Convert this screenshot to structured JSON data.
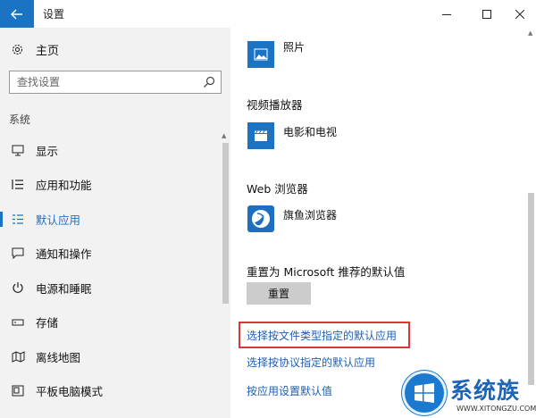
{
  "window": {
    "title": "设置",
    "back_icon": "arrow-left-icon",
    "controls": [
      "minimize-icon",
      "maximize-icon",
      "close-icon"
    ]
  },
  "sidebar": {
    "home_label": "主页",
    "home_icon": "gear-icon",
    "search": {
      "placeholder": "查找设置",
      "icon": "search-icon"
    },
    "section_label": "系统",
    "items": [
      {
        "label": "显示",
        "icon": "monitor-icon",
        "active": false
      },
      {
        "label": "应用和功能",
        "icon": "list-icon",
        "active": false
      },
      {
        "label": "默认应用",
        "icon": "default-apps-icon",
        "active": true
      },
      {
        "label": "通知和操作",
        "icon": "message-icon",
        "active": false
      },
      {
        "label": "电源和睡眠",
        "icon": "power-icon",
        "active": false
      },
      {
        "label": "存储",
        "icon": "storage-icon",
        "active": false
      },
      {
        "label": "离线地图",
        "icon": "map-icon",
        "active": false
      },
      {
        "label": "平板电脑模式",
        "icon": "tablet-icon",
        "active": false
      }
    ]
  },
  "content": {
    "photo_app": {
      "name": "照片",
      "icon": "photo-icon"
    },
    "video_heading": "视频播放器",
    "video_app": {
      "name": "电影和电视",
      "icon": "movie-clapper-icon"
    },
    "web_heading": "Web 浏览器",
    "web_app": {
      "name": "旗鱼浏览器",
      "icon": "browser-icon"
    },
    "reset_heading": "重置为 Microsoft 推荐的默认值",
    "reset_button": "重置",
    "links": [
      "选择按文件类型指定的默认应用",
      "选择按协议指定的默认应用",
      "按应用设置默认值"
    ]
  },
  "watermark": {
    "brand": "系统族",
    "url": "WWW.XITONGZU.COM"
  },
  "colors": {
    "accent": "#1b73c4",
    "sidebar_bg": "#f2f2f2",
    "highlight_box": "#d93838",
    "link": "#1f5fb4"
  }
}
